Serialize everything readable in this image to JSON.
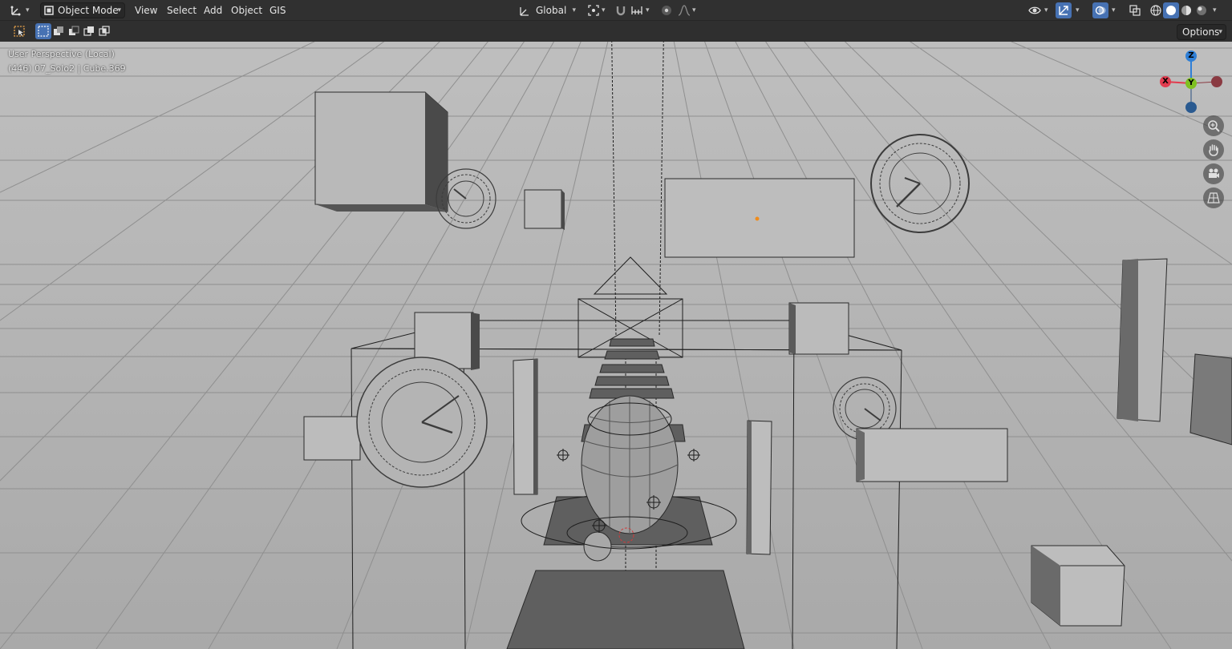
{
  "header": {
    "mode_label": "Object Mode",
    "menus": [
      "View",
      "Select",
      "Add",
      "Object",
      "GIS"
    ],
    "orientation_label": "Global",
    "icons": {
      "editor_type": "transform-axes-icon",
      "pivot": "pivot-point-icon",
      "snap": "magnet-icon",
      "snap_target": "snap-increment-icon",
      "proportional": "proportional-edit-icon",
      "falloff": "falloff-curve-icon",
      "visibility": "eye-icon",
      "gizmo": "gizmo-arrows-icon",
      "overlays": "overlays-icon",
      "xray": "xray-icon",
      "shading": [
        "wireframe-shading-icon",
        "solid-shading-icon",
        "material-shading-icon",
        "rendered-shading-icon"
      ]
    }
  },
  "tool_header": {
    "options_label": "Options",
    "select_modes": [
      "select-box-icon",
      "select-new-icon",
      "select-extend-icon",
      "select-subtract-icon",
      "select-intersect-icon"
    ]
  },
  "viewport": {
    "view_name": "User Perspective (Local)",
    "object_info": "(446) 07_Solo2 | Cube.369",
    "gizmo": {
      "x_label": "X",
      "y_label": "Y",
      "z_label": "Z"
    },
    "nav_buttons": [
      "zoom-icon",
      "pan-hand-icon",
      "camera-view-icon",
      "ortho-grid-icon"
    ]
  },
  "colors": {
    "header_bg": "#303030",
    "active_button": "#4772b3",
    "axis_x": "#e23c4f",
    "axis_y": "#7fc021",
    "axis_z": "#2f7fd6",
    "viewport_bg": "#b4b4b4"
  }
}
